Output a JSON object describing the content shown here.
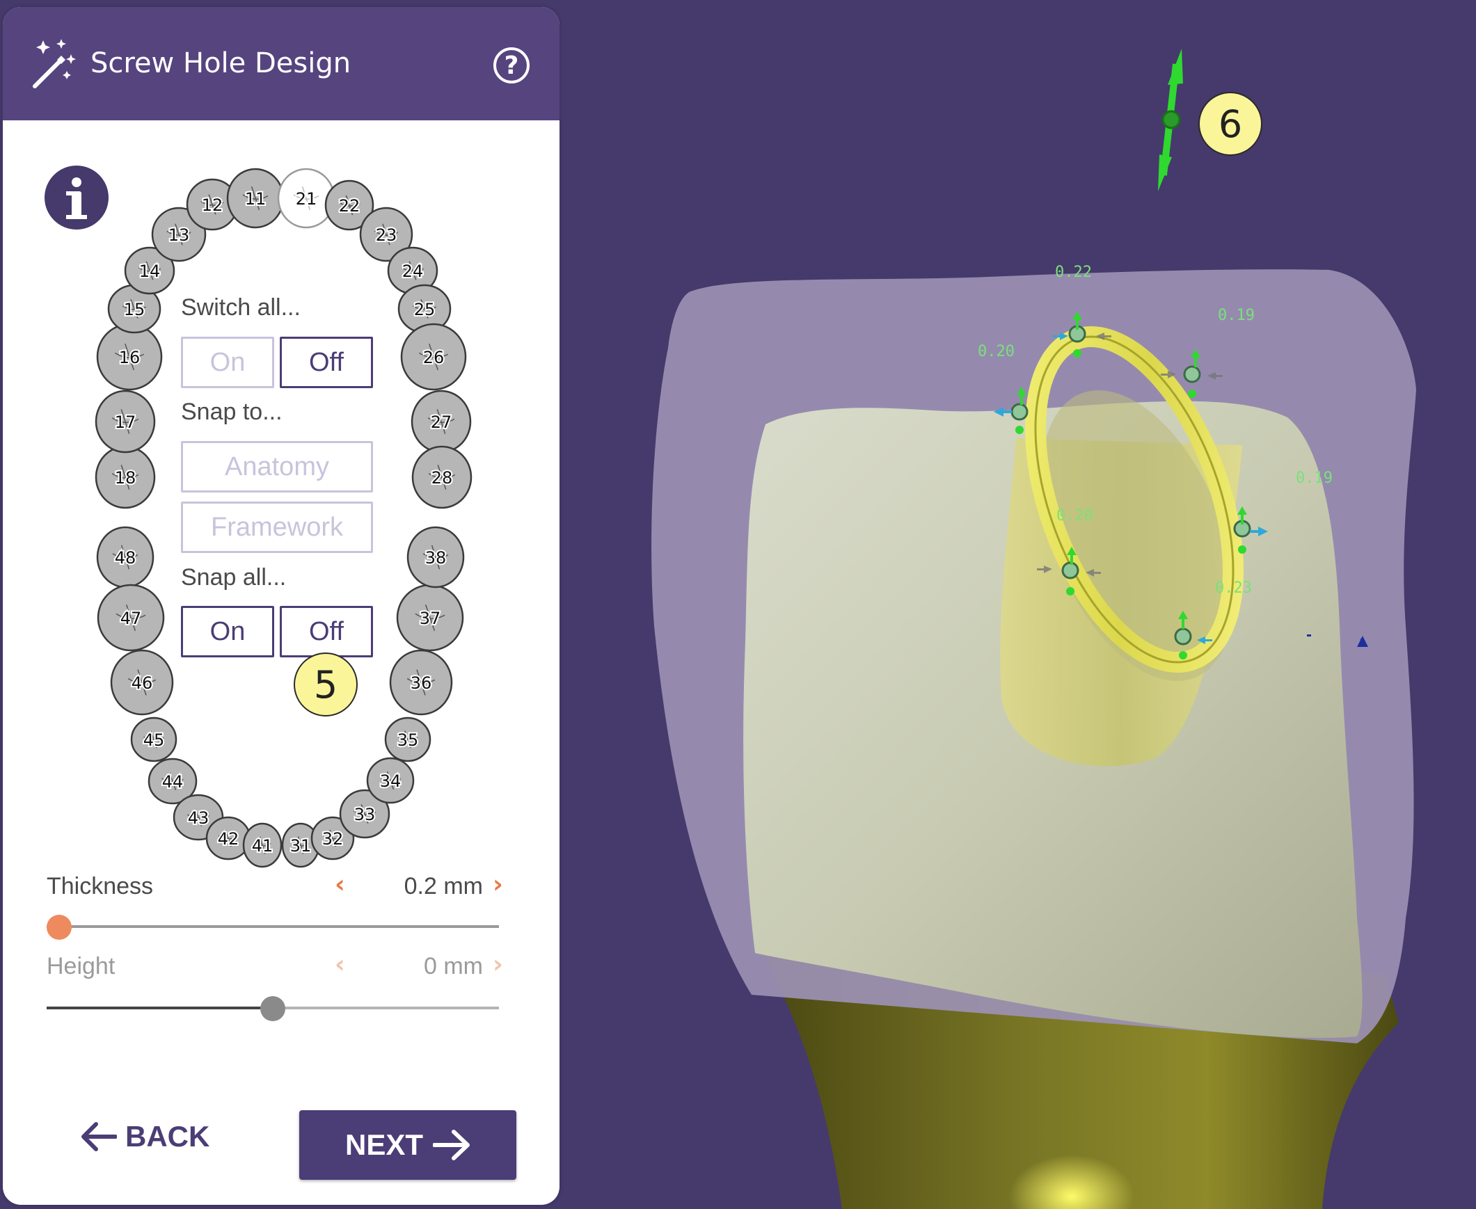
{
  "panel": {
    "title": "Screw Hole Design",
    "help_icon": "question-circle-icon",
    "title_icon": "magic-wand-icon",
    "info_icon": "info-icon"
  },
  "tooth_chart": {
    "upper": [
      "18",
      "17",
      "16",
      "15",
      "14",
      "13",
      "12",
      "11",
      "21",
      "22",
      "23",
      "24",
      "25",
      "26",
      "27",
      "28"
    ],
    "lower": [
      "48",
      "47",
      "46",
      "45",
      "44",
      "43",
      "42",
      "41",
      "31",
      "32",
      "33",
      "34",
      "35",
      "36",
      "37",
      "38"
    ],
    "selected": "21"
  },
  "switch_all": {
    "label": "Switch all...",
    "on": "On",
    "off": "Off"
  },
  "snap_to": {
    "label": "Snap to...",
    "anatomy": "Anatomy",
    "framework": "Framework"
  },
  "snap_all": {
    "label": "Snap all...",
    "on": "On",
    "off": "Off"
  },
  "thickness": {
    "label": "Thickness",
    "value": "0.2 mm",
    "slider_fraction": 0.0
  },
  "height": {
    "label": "Height",
    "value": "0 mm",
    "slider_fraction": 0.5
  },
  "buttons": {
    "back": "BACK",
    "next": "NEXT"
  },
  "callouts": {
    "left": "5",
    "right": "6"
  },
  "measurements": [
    "0.22",
    "0.19",
    "0.20",
    "0.19",
    "0.20",
    "0.23"
  ],
  "colors": {
    "background": "#453a6b",
    "header": "#56447f",
    "accent": "#4b3d76",
    "slider_active": "#ee8a5e",
    "ring": "#e8e66a",
    "arrow": "#2fd92f"
  }
}
